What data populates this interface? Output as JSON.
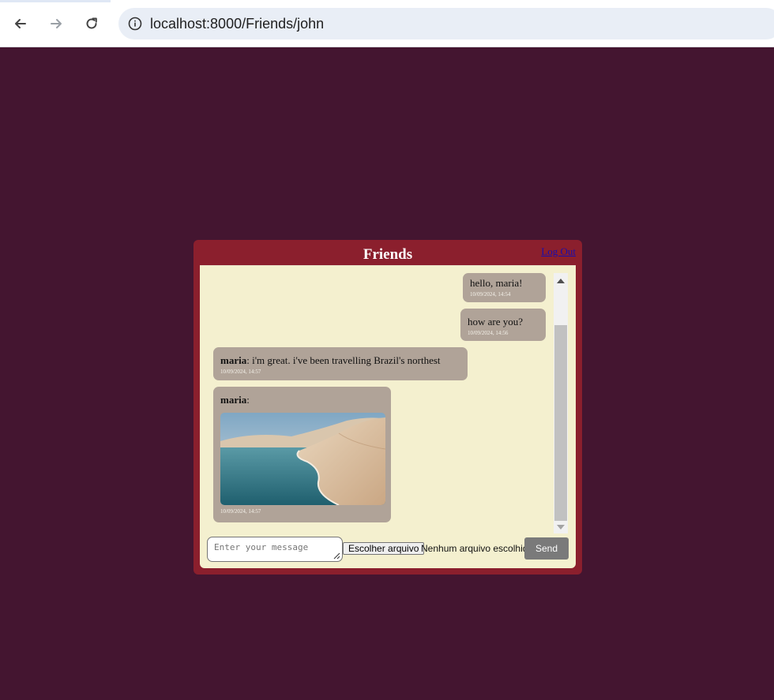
{
  "browser": {
    "url": "localhost:8000/Friends/john",
    "icons": [
      "back-arrow-icon",
      "forward-arrow-icon",
      "reload-icon",
      "site-info-icon"
    ]
  },
  "chat": {
    "title": "Friends",
    "logout_label": "Log Out",
    "messages": [
      {
        "sender": "",
        "text": "hello, maria!",
        "time": "10/09/2024, 14:54",
        "align": "right"
      },
      {
        "sender": "",
        "text": "how are you?",
        "time": "10/09/2024, 14:56",
        "align": "right"
      },
      {
        "sender": "maria",
        "text": ": i'm great. i've been travelling Brazil's northest",
        "time": "10/09/2024, 14:57",
        "align": "left"
      },
      {
        "sender": "maria",
        "text": ":",
        "time": "10/09/2024, 14:57",
        "align": "left",
        "image": "desert-lagoon-photo"
      }
    ],
    "input_placeholder": "Enter your message",
    "file_button_label": "Escolher arquivo",
    "file_status": "Nenhum arquivo escolhido",
    "send_label": "Send"
  },
  "colors": {
    "page_background": "#441530",
    "card_background": "#8b1f2d",
    "panel_background": "#f4f0cf",
    "bubble_background": "#b0a398",
    "send_button": "#7a7a7a"
  }
}
